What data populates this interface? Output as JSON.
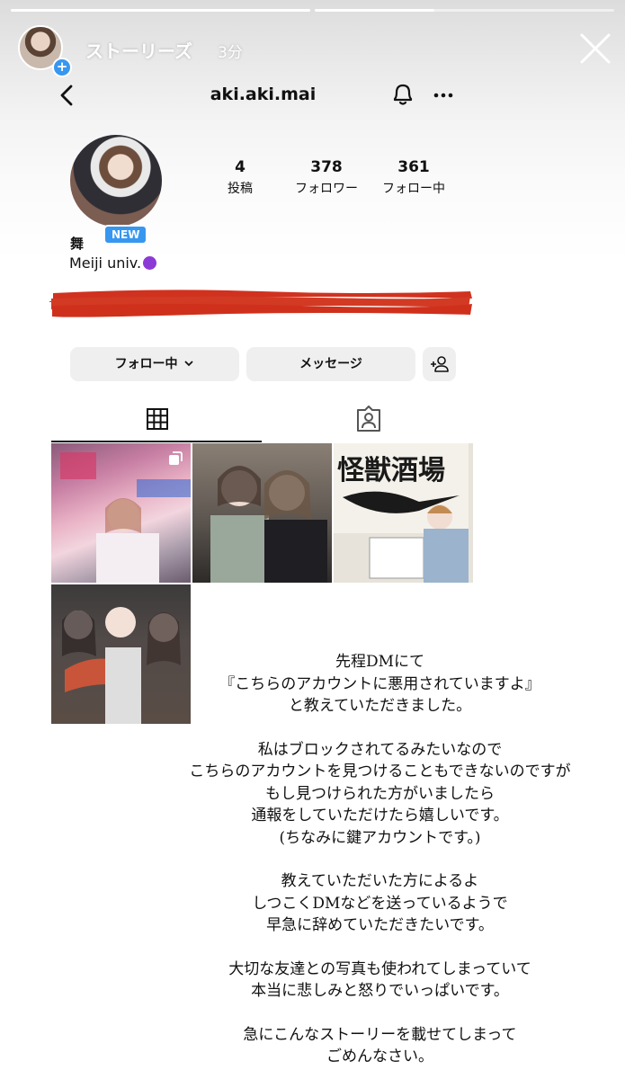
{
  "story": {
    "title": "ストーリーズ",
    "time": "3分",
    "progress": [
      1.0,
      0.4
    ]
  },
  "profile": {
    "username": "aki.aki.mai",
    "badge": "NEW",
    "name": "舞",
    "bio": "Meiji univ.",
    "stats": [
      {
        "num": "4",
        "label": "投稿"
      },
      {
        "num": "378",
        "label": "フォロワー"
      },
      {
        "num": "361",
        "label": "フォロー中"
      }
    ],
    "buttons": {
      "following": "フォロー中",
      "message": "メッセージ"
    }
  },
  "notice": {
    "p1": [
      "先程DMにて",
      "『こちらのアカウントに悪用されていますよ』",
      "と教えていただきました。"
    ],
    "p2": [
      "私はブロックされてるみたいなので",
      "こちらのアカウントを見つけることもできないのですが",
      "もし見つけられた方がいましたら",
      "通報をしていただけたら嬉しいです。",
      "(ちなみに鍵アカウントです。)"
    ],
    "p3": [
      "教えていただいた方によるよ",
      "しつこくDMなどを送っているようで",
      "早急に辞めていただきたいです。"
    ],
    "p4": [
      "大切な友達との写真も使われてしまっていて",
      "本当に悲しみと怒りでいっぱいです。"
    ],
    "p5": [
      "急にこんなストーリーを載せてしまって",
      "ごめんなさい。"
    ]
  },
  "posts": {
    "post3_sign": "怪獣酒場"
  },
  "colors": {
    "accent": "#3797f0",
    "redaction": "#d0321f"
  }
}
